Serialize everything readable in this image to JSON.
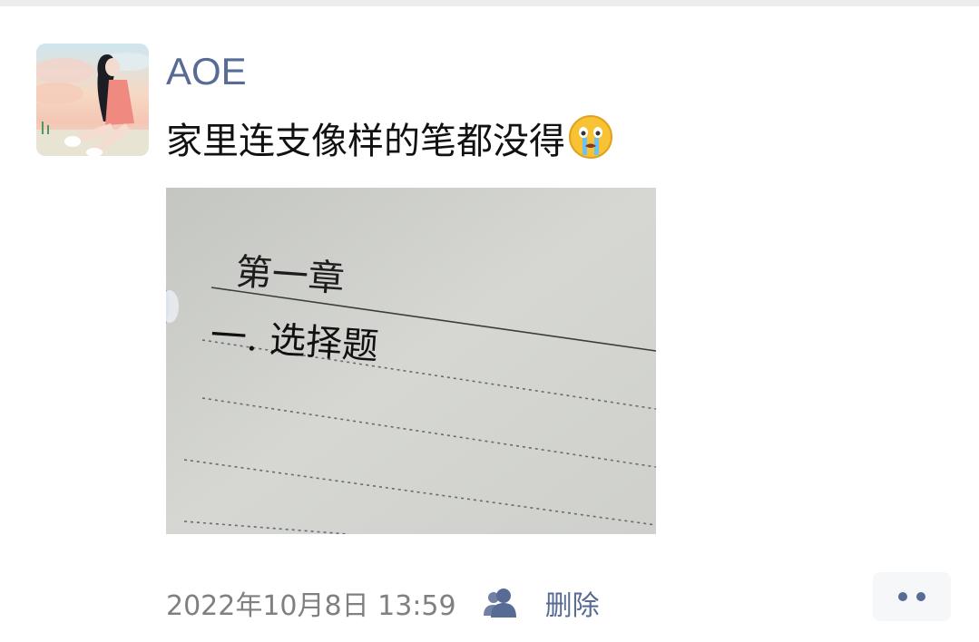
{
  "post": {
    "author": "AOE",
    "text": "家里连支像样的笔都没得",
    "emoji": "crying-face-emoji",
    "photo": {
      "handwriting_line1": "第一章",
      "handwriting_line2": "一. 选择题"
    },
    "timestamp": "2022年10月8日 13:59",
    "visibility_icon": "friends-icon",
    "delete_label": "删除",
    "more_icon": "more-dots-icon"
  },
  "colors": {
    "link": "#576b95",
    "text": "#111111",
    "meta": "#808080",
    "background": "#ffffff"
  }
}
